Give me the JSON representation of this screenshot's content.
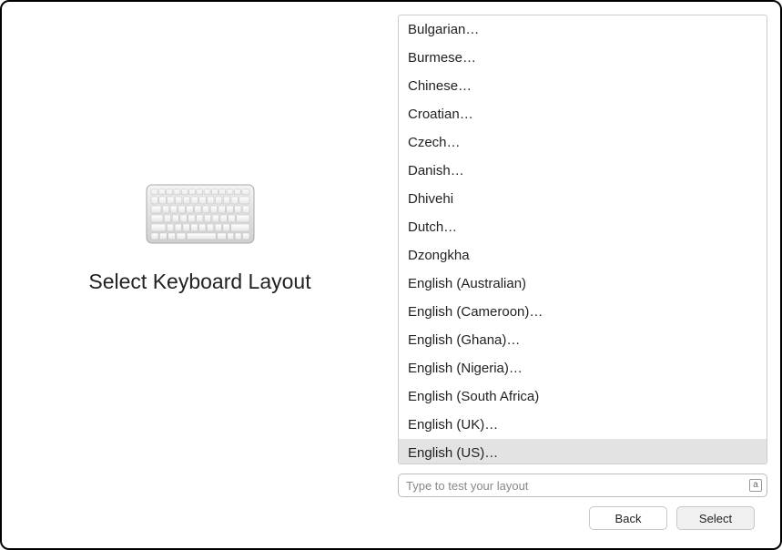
{
  "header": {
    "title": "Select Keyboard Layout"
  },
  "layouts": {
    "items": [
      {
        "label": "Bulgarian…",
        "selected": false
      },
      {
        "label": "Burmese…",
        "selected": false
      },
      {
        "label": "Chinese…",
        "selected": false
      },
      {
        "label": "Croatian…",
        "selected": false
      },
      {
        "label": "Czech…",
        "selected": false
      },
      {
        "label": "Danish…",
        "selected": false
      },
      {
        "label": "Dhivehi",
        "selected": false
      },
      {
        "label": "Dutch…",
        "selected": false
      },
      {
        "label": "Dzongkha",
        "selected": false
      },
      {
        "label": "English (Australian)",
        "selected": false
      },
      {
        "label": "English (Cameroon)…",
        "selected": false
      },
      {
        "label": "English (Ghana)…",
        "selected": false
      },
      {
        "label": "English (Nigeria)…",
        "selected": false
      },
      {
        "label": "English (South Africa)",
        "selected": false
      },
      {
        "label": "English (UK)…",
        "selected": false
      },
      {
        "label": "English (US)…",
        "selected": true
      }
    ]
  },
  "test_input": {
    "placeholder": "Type to test your layout",
    "value": "",
    "indicator": "a"
  },
  "buttons": {
    "back": "Back",
    "select": "Select"
  },
  "icons": {
    "keyboard": "keyboard-icon"
  }
}
